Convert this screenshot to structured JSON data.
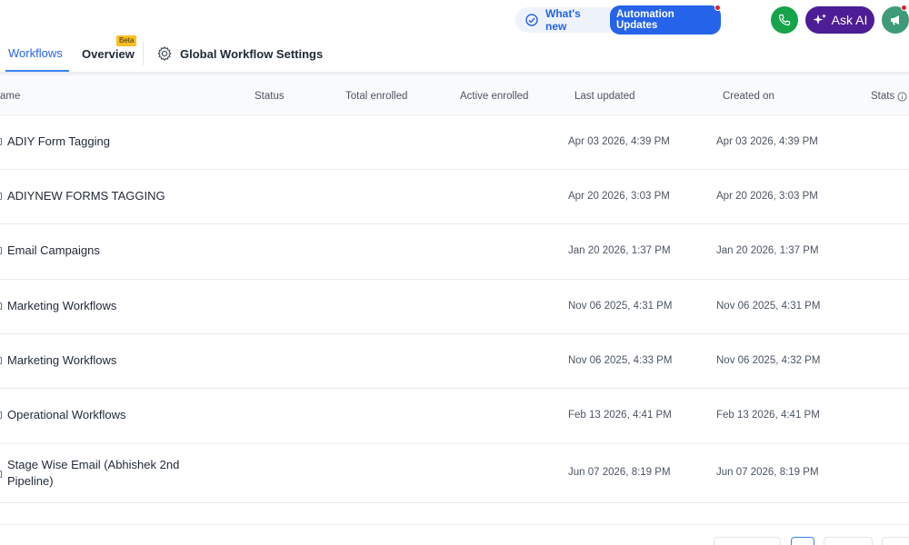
{
  "topbar": {
    "whats_new_label": "What's new",
    "automation_updates_label": "Automation Updates",
    "ask_ai_label": "Ask AI"
  },
  "tabs": [
    {
      "label": "Workflows",
      "active": true
    },
    {
      "label": "Overview",
      "badge": "Beta"
    },
    {
      "label": "Global Workflow Settings",
      "icon": "gear-icon"
    }
  ],
  "table": {
    "columns": [
      "ame",
      "Status",
      "Total enrolled",
      "Active enrolled",
      "Last updated",
      "Created on",
      "Stats"
    ],
    "rows": [
      {
        "name": "ADIY Form Tagging",
        "last_updated": "Apr 03 2026, 4:39 PM",
        "created_on": "Apr 03 2026, 4:39 PM"
      },
      {
        "name": "ADIYNEW FORMS TAGGING",
        "last_updated": "Apr 20 2026, 3:03 PM",
        "created_on": "Apr 20 2026, 3:03 PM"
      },
      {
        "name": "Email Campaigns",
        "last_updated": "Jan 20 2026, 1:37 PM",
        "created_on": "Jan 20 2026, 1:37 PM"
      },
      {
        "name": "Marketing Workflows",
        "last_updated": "Nov 06 2025, 4:31 PM",
        "created_on": "Nov 06 2025, 4:31 PM"
      },
      {
        "name": "Marketing Workflows",
        "last_updated": "Nov 06 2025, 4:33 PM",
        "created_on": "Nov 06 2025, 4:32 PM"
      },
      {
        "name": "Operational Workflows",
        "last_updated": "Feb 13 2026, 4:41 PM",
        "created_on": "Feb 13 2026, 4:41 PM"
      },
      {
        "name": "Stage Wise Email (Abhishek 2nd Pipeline)",
        "last_updated": "Jun 07 2026, 8:19 PM",
        "created_on": "Jun 07 2026, 8:19 PM"
      }
    ]
  },
  "colors": {
    "accent": "#2563eb",
    "phone": "#16a34a",
    "ask_ai": "#4c1d95",
    "notification": "#e11d2e",
    "beta": "#fbbf24"
  }
}
